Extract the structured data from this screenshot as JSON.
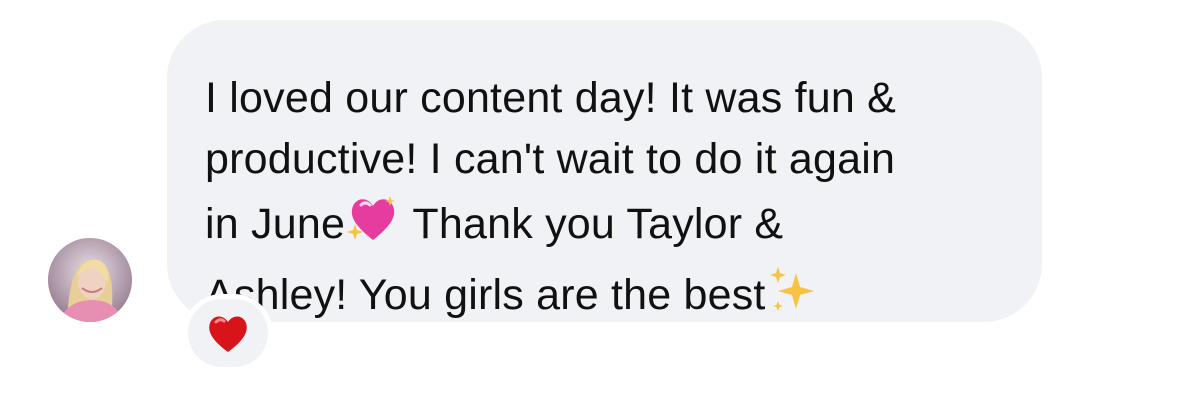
{
  "message": {
    "line1": "I loved our content day! It was fun &",
    "line2": "productive! I can't wait to do it again",
    "line3_before": "in June",
    "line3_emoji": "sparkling-heart",
    "line3_after": " Thank you Taylor &",
    "line4_before": "Ashley! You girls are the best",
    "line4_emoji": "sparkles"
  },
  "reaction": {
    "icon": "red-heart",
    "color": "#d9131a"
  },
  "colors": {
    "bubble": "#f1f2f6",
    "text": "#111111",
    "accent_heart": "#e63ca0",
    "sparkle": "#f6c343"
  }
}
